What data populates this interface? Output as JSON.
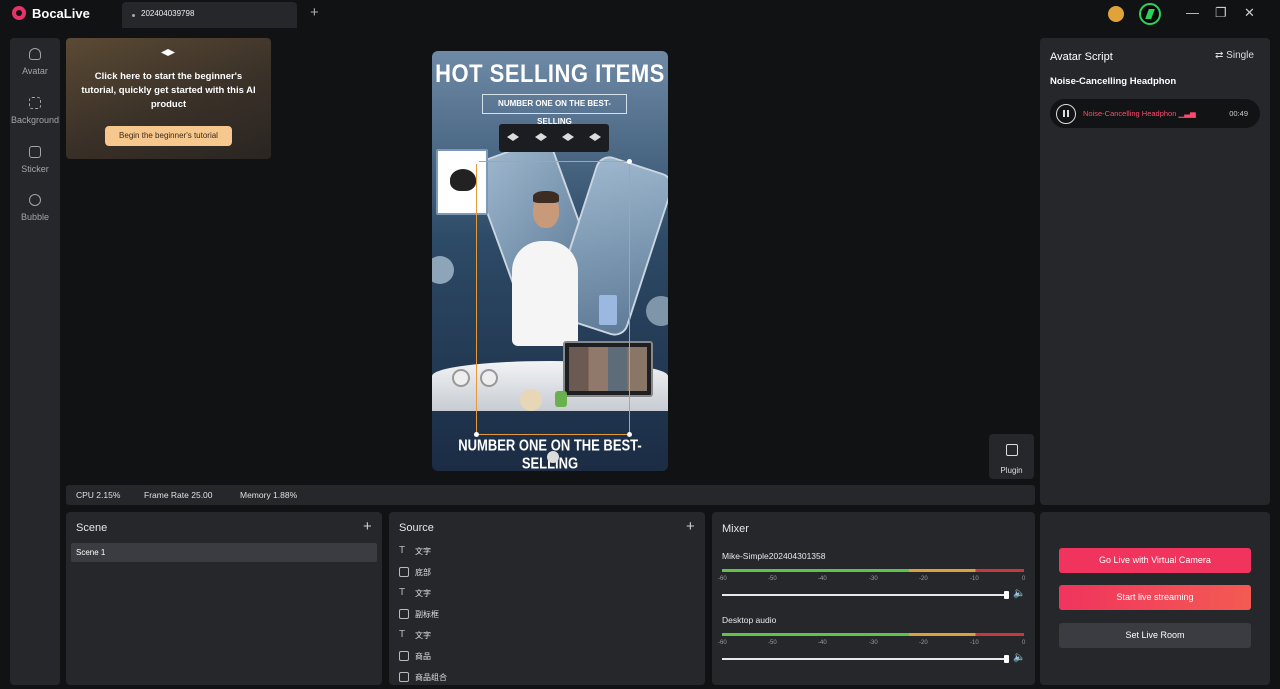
{
  "app": {
    "title": "BocaLive",
    "tab_label": "202404039798"
  },
  "titlebar": {
    "add_tab": "+",
    "minimize": "—",
    "restore": "❐",
    "close": "✕"
  },
  "sidebar": {
    "items": [
      {
        "label": "Avatar",
        "icon": "person-icon"
      },
      {
        "label": "Background",
        "icon": "background-icon"
      },
      {
        "label": "Sticker",
        "icon": "sticker-icon"
      },
      {
        "label": "Bubble",
        "icon": "bubble-icon"
      }
    ]
  },
  "tutorial": {
    "text": "Click here to start the beginner's tutorial, quickly get started with this AI product",
    "button": "Begin the beginner's tutorial"
  },
  "preview": {
    "title": "HOT SELLING ITEMS",
    "subtitle": "NUMBER ONE ON THE BEST-SELLING",
    "bottom_text": "NUMBER ONE ON THE BEST-SELLING"
  },
  "plugin": {
    "label": "Plugin"
  },
  "stats": {
    "cpu": "CPU 2.15%",
    "frame_rate": "Frame Rate 25.00",
    "memory": "Memory 1.88%"
  },
  "scene": {
    "title": "Scene",
    "add": "+",
    "items": [
      "Scene 1"
    ]
  },
  "source": {
    "title": "Source",
    "add": "+",
    "items": [
      {
        "label": "文字",
        "icon": "text-icon"
      },
      {
        "label": "底部",
        "icon": "image-icon"
      },
      {
        "label": "文字",
        "icon": "text-icon"
      },
      {
        "label": "副标框",
        "icon": "image-icon"
      },
      {
        "label": "文字",
        "icon": "text-icon"
      },
      {
        "label": "商品",
        "icon": "image-icon"
      },
      {
        "label": "商品组合",
        "icon": "image-icon"
      }
    ]
  },
  "mixer": {
    "title": "Mixer",
    "ticks": [
      "-60",
      "-50",
      "-40",
      "-30",
      "-20",
      "-10",
      "0"
    ],
    "channels": [
      {
        "name": "Mike-Simple202404301358",
        "volume": 1.0
      },
      {
        "name": "Desktop audio",
        "volume": 1.0
      }
    ]
  },
  "script": {
    "title": "Avatar Script",
    "mode": "Single",
    "name": "Noise-Cancelling Headphon",
    "item_title": "Noise-Cancelling Headphon",
    "item_time": "00:49"
  },
  "actions": {
    "virtual_camera": "Go Live with Virtual Camera",
    "start_streaming": "Start live streaming",
    "set_room": "Set Live Room"
  },
  "colors": {
    "accent": "#f0345e",
    "tutorial_button": "#f6c88e",
    "selection": "#e29a3c",
    "panel": "#26272b"
  }
}
